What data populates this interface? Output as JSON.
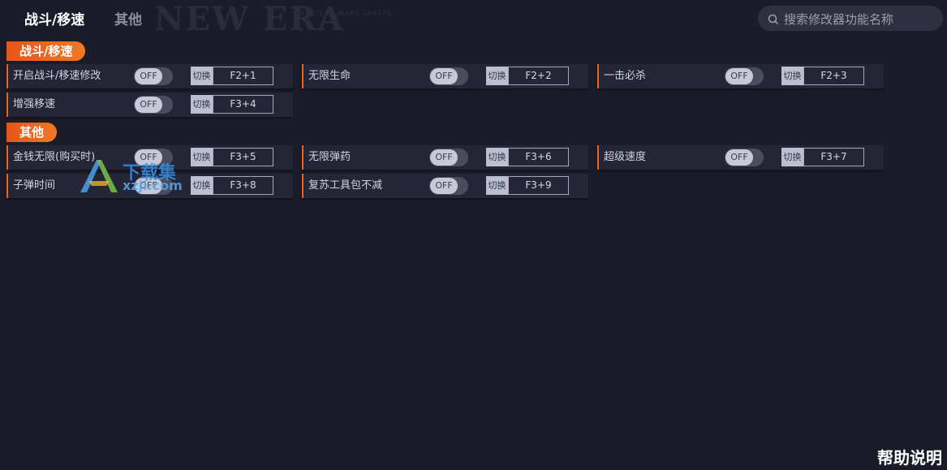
{
  "background_deco": {
    "text": "NEW ERA",
    "small": "ANCIENT WARS SPARTA"
  },
  "tabs": [
    {
      "label": "战斗/移速",
      "active": true
    },
    {
      "label": "其他",
      "active": false
    }
  ],
  "search": {
    "placeholder": "搜索修改器功能名称",
    "value": ""
  },
  "sections": [
    {
      "title": "战斗/移速",
      "items": [
        {
          "label": "开启战斗/移速修改",
          "state": "OFF",
          "hotkey_label": "切换",
          "hotkey": "F2+1"
        },
        {
          "label": "无限生命",
          "state": "OFF",
          "hotkey_label": "切换",
          "hotkey": "F2+2"
        },
        {
          "label": "一击必杀",
          "state": "OFF",
          "hotkey_label": "切换",
          "hotkey": "F2+3"
        },
        {
          "label": "增强移速",
          "state": "OFF",
          "hotkey_label": "切换",
          "hotkey": "F3+4"
        }
      ]
    },
    {
      "title": "其他",
      "items": [
        {
          "label": "金钱无限(购买时)",
          "state": "OFF",
          "hotkey_label": "切换",
          "hotkey": "F3+5"
        },
        {
          "label": "无限弹药",
          "state": "OFF",
          "hotkey_label": "切换",
          "hotkey": "F3+6"
        },
        {
          "label": "超级速度",
          "state": "OFF",
          "hotkey_label": "切换",
          "hotkey": "F3+7"
        },
        {
          "label": "子弹时间",
          "state": "OFF",
          "hotkey_label": "切换",
          "hotkey": "F3+8"
        },
        {
          "label": "复苏工具包不减",
          "state": "OFF",
          "hotkey_label": "切换",
          "hotkey": "F3+9"
        }
      ]
    }
  ],
  "help_label": "帮助说明",
  "watermark": {
    "text": "下载集",
    "url": "xzji.com"
  },
  "colors": {
    "accent": "#e8641e",
    "background": "#1b1c2a",
    "row_bg": "#242637"
  }
}
